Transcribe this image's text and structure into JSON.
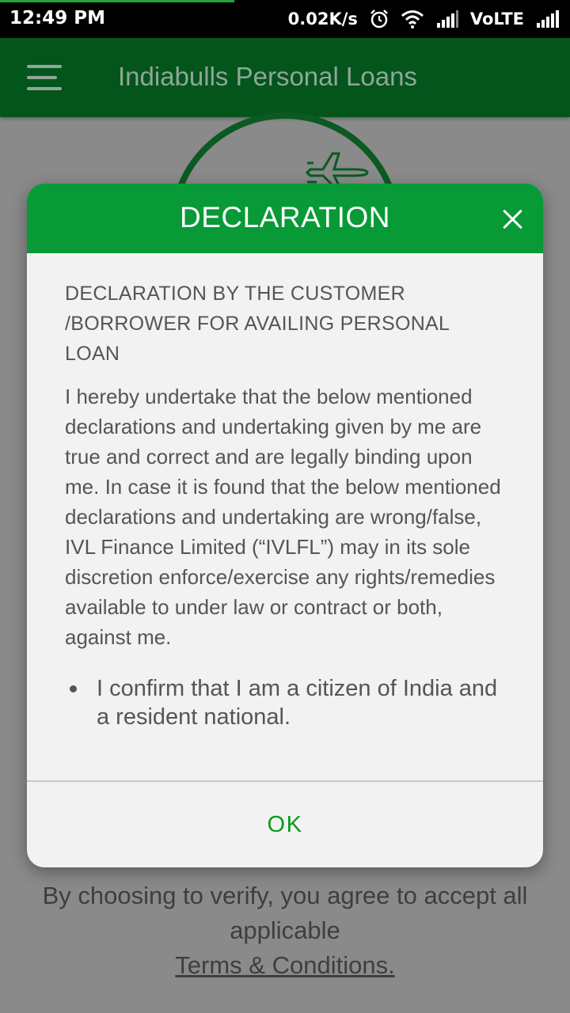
{
  "status_bar": {
    "time": "12:49 PM",
    "net_speed": "0.02K/s",
    "network_label": "VoLTE",
    "icons": [
      "alarm-icon",
      "wifi-icon",
      "signal-icon",
      "signal-icon"
    ]
  },
  "app_bar": {
    "title": "Indiabulls Personal Loans",
    "menu_icon": "hamburger-menu-icon",
    "color": "#04551c"
  },
  "background": {
    "plane_icon": "airplane-icon",
    "footer_text": "By choosing to verify, you agree to accept all applicable",
    "terms_link": "Terms & Conditions."
  },
  "dialog": {
    "title": "DECLARATION",
    "header_color": "#079a36",
    "close_icon": "close-icon",
    "heading": "DECLARATION BY THE CUSTOMER /BORROWER FOR AVAILING PERSONAL LOAN",
    "paragraph": "I hereby undertake that the below mentioned declarations and undertaking given by me are true and correct and are legally binding upon me. In case it is found that the below mentioned declarations and undertaking are wrong/false, IVL Finance Limited (“IVLFL”) may in its sole discretion enforce/exercise any rights/remedies available to under law or contract or both, against me.",
    "items": [
      "I confirm that I am a citizen of India and a resident national."
    ],
    "ok_label": "OK",
    "ok_color": "#0a9a1a"
  }
}
